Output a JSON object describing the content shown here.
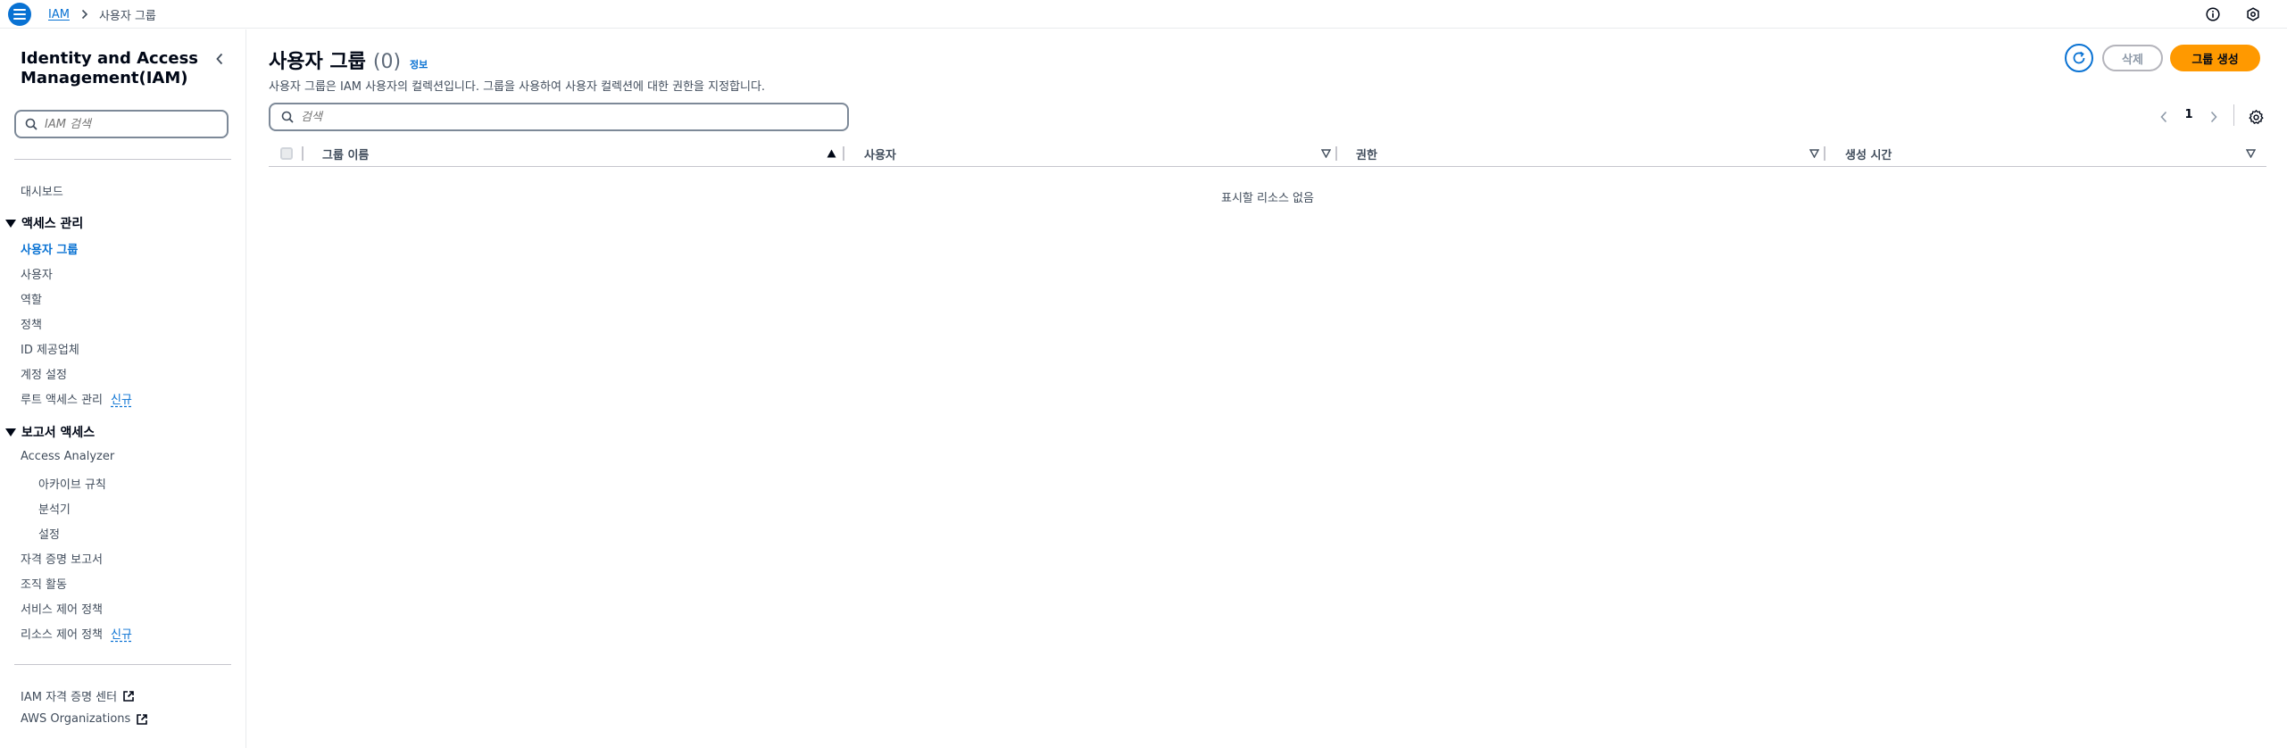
{
  "breadcrumb": {
    "root": "IAM",
    "current": "사용자 그룹"
  },
  "sidebar": {
    "title": "Identity and Access Management(IAM)",
    "search_placeholder": "IAM 검색",
    "dashboard": "대시보드",
    "sections": {
      "access_management": "액세스 관리",
      "reports_access": "보고서 액세스"
    },
    "access_items": {
      "user_groups": "사용자 그룹",
      "users": "사용자",
      "roles": "역할",
      "policies": "정책",
      "identity_providers": "ID 제공업체",
      "account_settings": "계정 설정",
      "root_access": "루트 액세스 관리",
      "root_access_badge": "신규"
    },
    "report_items": {
      "access_analyzer": "Access Analyzer",
      "archive_rules": "아카이브 규칙",
      "analyzers": "분석기",
      "settings": "설정",
      "credential_report": "자격 증명 보고서",
      "org_activity": "조직 활동",
      "scp": "서비스 제어 정책",
      "rcp": "리소스 제어 정책",
      "rcp_badge": "신규"
    },
    "footer_links": {
      "identity_center": "IAM 자격 증명 센터",
      "organizations": "AWS Organizations"
    }
  },
  "main": {
    "title": "사용자 그룹",
    "count": "(0)",
    "info_link": "정보",
    "description": "사용자 그룹은 IAM 사용자의 컬렉션입니다. 그룹을 사용하여 사용자 컬렉션에 대한 권한을 지정합니다.",
    "delete_button": "삭제",
    "create_button": "그룹 생성",
    "search_placeholder": "검색",
    "page_number": "1",
    "columns": {
      "group_name": "그룹 이름",
      "users": "사용자",
      "permissions": "권한",
      "created": "생성 시간"
    },
    "empty_message": "표시할 리소스 없음"
  },
  "colors": {
    "primary_blue": "#0972d3",
    "create_orange": "#ff9900",
    "text_dark": "#000716",
    "text_muted": "#414d5c"
  }
}
